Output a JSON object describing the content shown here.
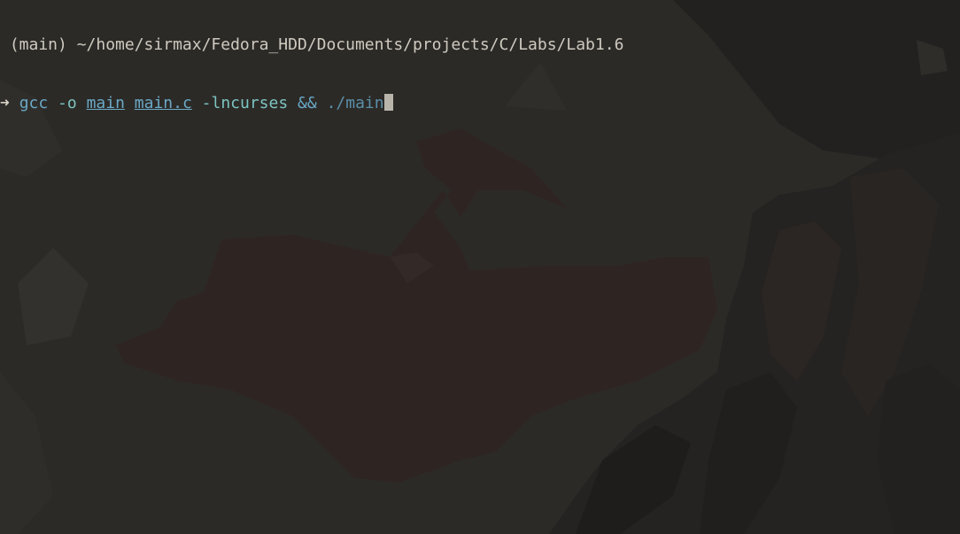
{
  "prompt": {
    "git_icon": "",
    "path_text": " (main) ~/home/sirmax/Fedora_HDD/Documents/projects/C/Labs/Lab1.6",
    "arrow": "➜",
    "command": {
      "program": "gcc",
      "flag_o": "-o",
      "output_name": "main",
      "source_file": "main.c",
      "flag_lib": "-lncurses",
      "operator": "&&",
      "exec": "./main"
    }
  },
  "colors": {
    "prompt_icon": "#e5b93f",
    "command": "#6aa9c7",
    "background": "#2c2a27"
  }
}
